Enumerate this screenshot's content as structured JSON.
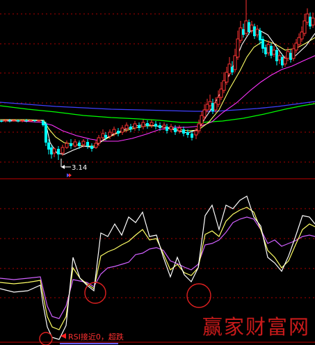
{
  "price_panel": {
    "low_marker_label": "3.14"
  },
  "rsi_panel": {
    "annotation": "RSI接近0，超跌"
  },
  "watermark": "赢家财富网",
  "colors": {
    "background": "#000000",
    "up_candle": "#ff3232",
    "down_candle": "#00ffff",
    "ma_white": "#ffffff",
    "ma_yellow": "#ffff66",
    "ma_magenta": "#ff33ff",
    "ma_green": "#00ff00",
    "ma_blue": "#4040ff",
    "grid_red": "#b00000",
    "rsi_white": "#ffffff",
    "rsi_yellow": "#ffff66",
    "rsi_magenta": "#d060ff",
    "circle_red": "#e02020"
  }
}
